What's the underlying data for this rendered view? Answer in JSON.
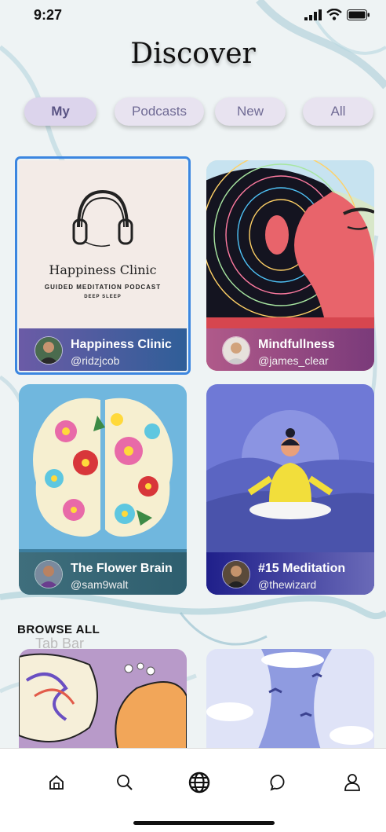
{
  "status": {
    "time": "9:27"
  },
  "title": "Discover",
  "tabs": [
    {
      "label": "My",
      "active": true
    },
    {
      "label": "Podcasts",
      "active": false
    },
    {
      "label": "New",
      "active": false
    },
    {
      "label": "All",
      "active": false
    }
  ],
  "cards": [
    {
      "title": "Happiness Clinic",
      "handle": "@ridzjcob",
      "art": {
        "heading": "Happiness Clinic",
        "sub": "GUIDED MEDITATION PODCAST",
        "sub2": "DEEP SLEEP"
      },
      "selected": true
    },
    {
      "title": "Mindfullness",
      "handle": "@james_clear"
    },
    {
      "title": "The Flower Brain",
      "handle": "@sam9walt"
    },
    {
      "title": "#15 Meditation",
      "handle": "@thewizard"
    }
  ],
  "browse_label": "BROWSE ALL",
  "ghost_label": "Tab Bar",
  "nav": [
    "home-icon",
    "search-icon",
    "globe-icon",
    "chat-icon",
    "profile-icon"
  ],
  "colors": {
    "accent": "#3b86e0",
    "tab_bg": "#e8e3f0",
    "tab_text": "#6f6a94"
  }
}
